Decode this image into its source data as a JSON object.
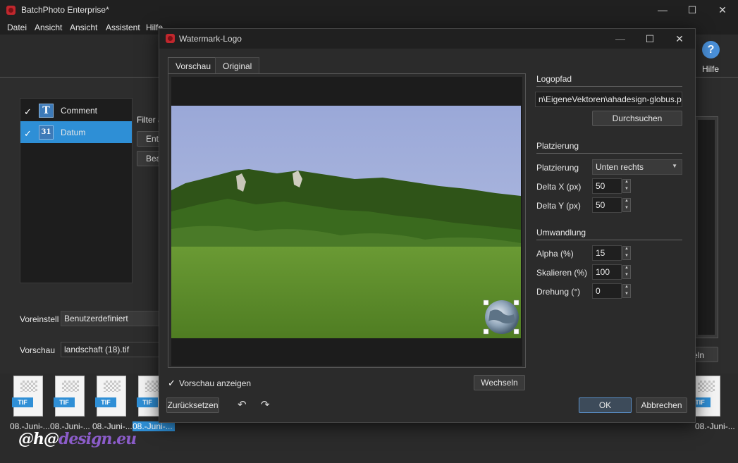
{
  "app": {
    "title": "BatchPhoto Enterprise*",
    "menu": [
      "Datei",
      "Ansicht",
      "Ansicht",
      "Assistent",
      "Hilfe"
    ],
    "help_label": "Hilfe",
    "help_glyph": "?",
    "list": [
      {
        "label": "Comment",
        "icon": "T",
        "checked": "✓"
      },
      {
        "label": "Datum",
        "icon": "31",
        "checked": "✓"
      }
    ],
    "side_buttons": [
      "Filter a",
      "Ent",
      "Bea"
    ],
    "voreinstell_label": "Voreinstell",
    "voreinstell_value": "Benutzerdefiniert",
    "vorschau_label": "Vorschau",
    "vorschau_value": "landschaft (18).tif",
    "right_button": "eln",
    "thumb_badge": "TIF",
    "thumb_label": "08.-Juni-...",
    "watermark_a": "@h@",
    "watermark_b": "design.eu"
  },
  "dialog": {
    "title": "Watermark-Logo",
    "tabs": [
      "Vorschau",
      "Original"
    ],
    "logopfad_header": "Logopfad",
    "logopfad_value": "n\\EigeneVektoren\\ahadesign-globus.png",
    "browse_button": "Durchsuchen",
    "placement_header": "Platzierung",
    "placement_label": "Platzierung",
    "placement_value": "Unten rechts",
    "delta_x_label": "Delta X (px)",
    "delta_x_value": "50",
    "delta_y_label": "Delta Y (px)",
    "delta_y_value": "50",
    "transform_header": "Umwandlung",
    "alpha_label": "Alpha (%)",
    "alpha_value": "15",
    "scale_label": "Skalieren (%)",
    "scale_value": "100",
    "rotation_label": "Drehung (°)",
    "rotation_value": "0",
    "show_preview_label": "Vorschau anzeigen",
    "show_preview_check": "✓",
    "switch_button": "Wechseln",
    "reset_button": "Zurücksetzen",
    "undo_glyph": "↶",
    "redo_glyph": "↷",
    "ok_button": "OK",
    "cancel_button": "Abbrechen"
  },
  "colors": {
    "accent": "#2e8fd6",
    "app_icon": "#c0272d",
    "sky": "#a5b3dc",
    "grass": "#5f8f2c",
    "forest": "#2f5418"
  }
}
